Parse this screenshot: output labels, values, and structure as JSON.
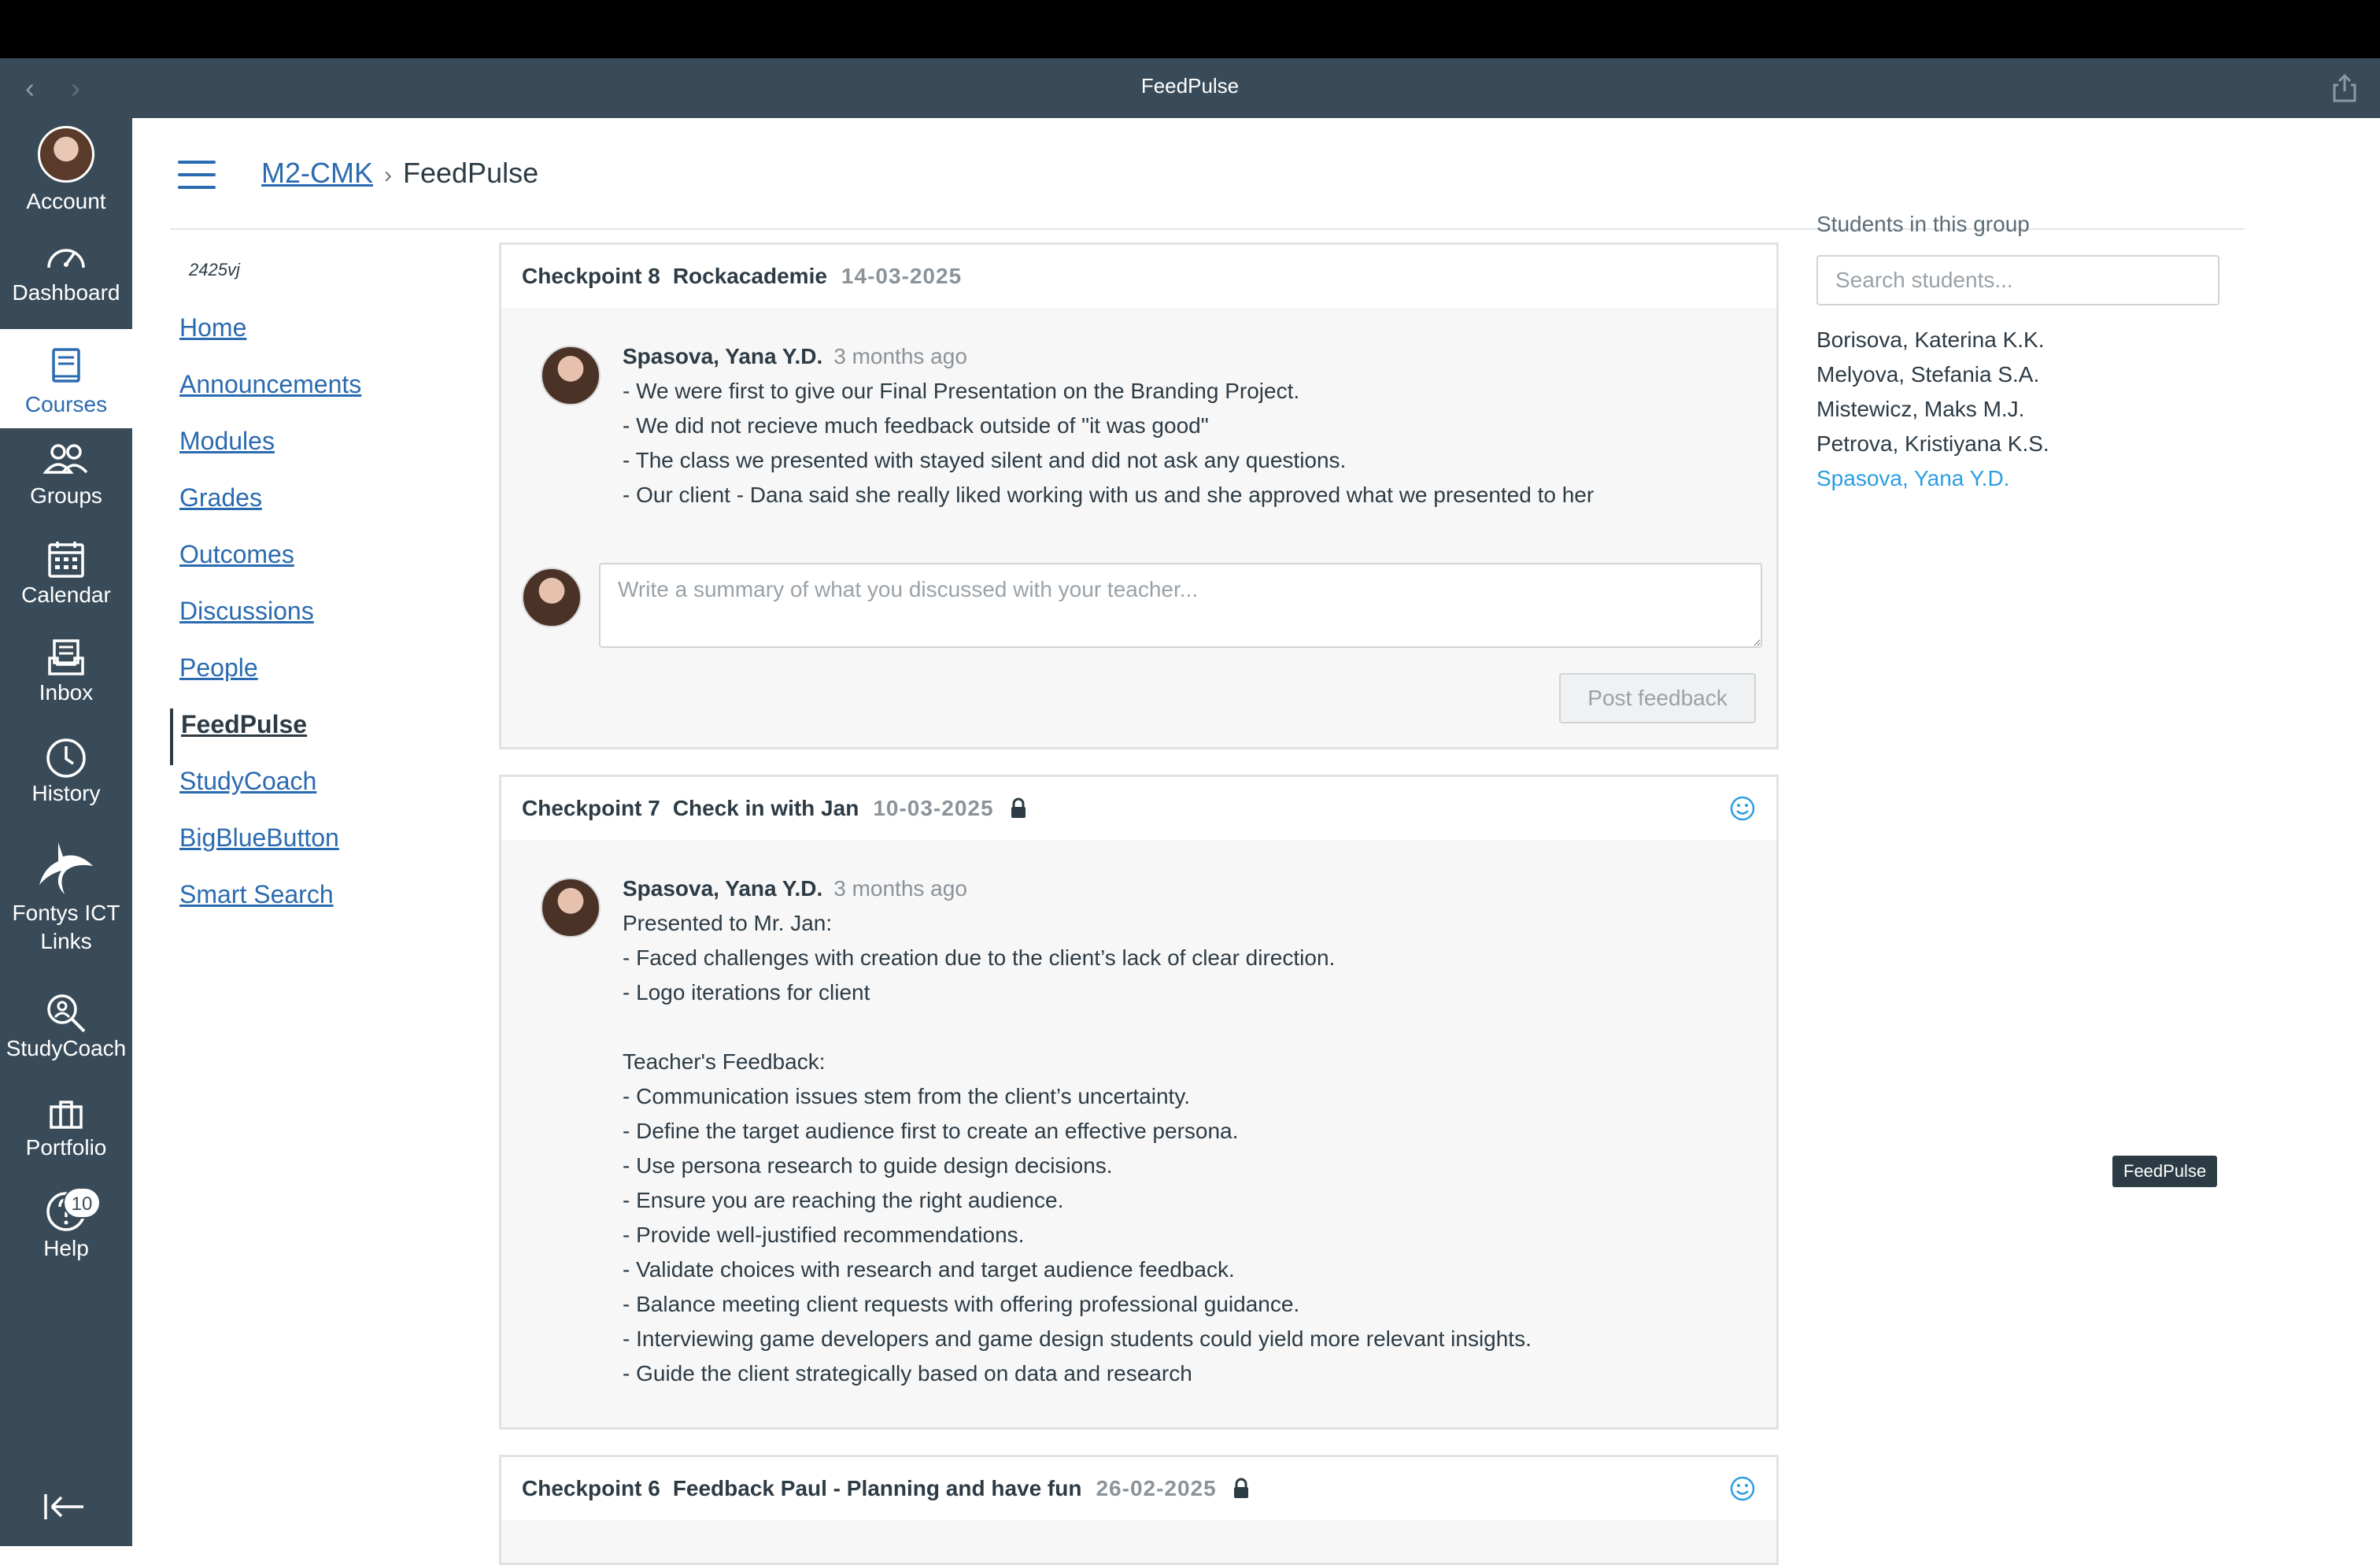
{
  "window": {
    "title": "FeedPulse"
  },
  "global_nav": {
    "items": [
      {
        "key": "account",
        "label": "Account",
        "icon": "avatar"
      },
      {
        "key": "dashboard",
        "label": "Dashboard",
        "icon": "dashboard-icon"
      },
      {
        "key": "courses",
        "label": "Courses",
        "icon": "courses-icon",
        "active": true
      },
      {
        "key": "groups",
        "label": "Groups",
        "icon": "groups-icon"
      },
      {
        "key": "calendar",
        "label": "Calendar",
        "icon": "calendar-icon"
      },
      {
        "key": "inbox",
        "label": "Inbox",
        "icon": "inbox-icon"
      },
      {
        "key": "history",
        "label": "History",
        "icon": "history-icon"
      },
      {
        "key": "fontys",
        "label": "Fontys ICT Links",
        "icon": "fontys-logo-icon"
      },
      {
        "key": "studycoach",
        "label": "StudyCoach",
        "icon": "studycoach-icon"
      },
      {
        "key": "portfolio",
        "label": "Portfolio",
        "icon": "portfolio-icon"
      },
      {
        "key": "help",
        "label": "Help",
        "icon": "help-icon",
        "badge": "10"
      }
    ]
  },
  "breadcrumb": {
    "course": "M2-CMK",
    "separator": "›",
    "current": "FeedPulse"
  },
  "course_nav": {
    "code": "2425vj",
    "items": [
      "Home",
      "Announcements",
      "Modules",
      "Grades",
      "Outcomes",
      "Discussions",
      "People",
      "FeedPulse",
      "StudyCoach",
      "BigBlueButton",
      "Smart Search"
    ],
    "active": "FeedPulse"
  },
  "checkpoints": [
    {
      "number": "Checkpoint 8",
      "name": "Rockacademie",
      "date": "14-03-2025",
      "author": "Spasova, Yana Y.D.",
      "ago": "3 months ago",
      "lines": [
        "- We were first to give our Final Presentation on the Branding Project.",
        "- We did not recieve much feedback outside of \"it was good\"",
        "- The class we presented with stayed silent and did not ask any questions.",
        "- Our client - Dana said she really liked working with us and she approved what we presented to her"
      ],
      "reply_placeholder": "Write a summary of what you discussed with your teacher...",
      "post_label": "Post feedback"
    },
    {
      "number": "Checkpoint 7",
      "name": "Check in with Jan",
      "date": "10-03-2025",
      "author": "Spasova, Yana Y.D.",
      "ago": "3 months ago",
      "lines": [
        "Presented to Mr. Jan:",
        "- Faced challenges with creation due to the client’s lack of clear direction.",
        "- Logo iterations for client",
        "",
        "Teacher's Feedback:",
        "- Communication issues stem from the client’s uncertainty.",
        "- Define the target audience first to create an effective persona.",
        "- Use persona research to guide design decisions.",
        "- Ensure you are reaching the right audience.",
        "- Provide well-justified recommendations.",
        "- Validate choices with research and target audience feedback.",
        "- Balance meeting client requests with offering professional guidance.",
        "- Interviewing game developers and game design students could yield more relevant insights.",
        "- Guide the client strategically based on data and research"
      ]
    },
    {
      "number": "Checkpoint 6",
      "name": "Feedback Paul - Planning and have fun",
      "date": "26-02-2025"
    }
  ],
  "students_panel": {
    "heading": "Students in this group",
    "search_placeholder": "Search students...",
    "students": [
      "Borisova, Katerina K.K.",
      "Melyova, Stefania S.A.",
      "Mistewicz, Maks M.J.",
      "Petrova, Kristiyana K.S.",
      "Spasova, Yana Y.D."
    ],
    "current": "Spasova, Yana Y.D."
  },
  "tooltip": "FeedPulse",
  "colors": {
    "nav_bg": "#394b58",
    "link": "#2b6bb0",
    "highlight": "#2b9ee0"
  }
}
